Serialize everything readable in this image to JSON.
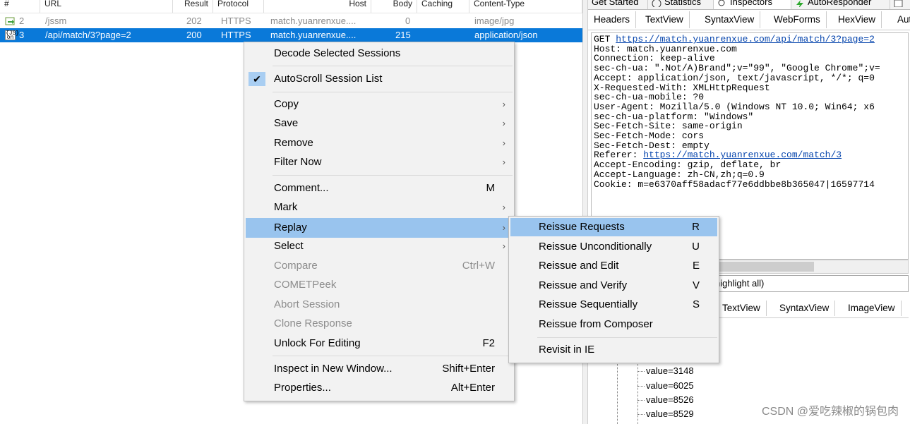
{
  "session_list": {
    "headers": [
      "#",
      "URL",
      "Result",
      "Protocol",
      "Host",
      "Body",
      "Caching",
      "Content-Type"
    ],
    "rows": [
      {
        "icon": "image-icon",
        "num": "2",
        "url": "/jssm",
        "result": "202",
        "protocol": "HTTPS",
        "host": "match.yuanrenxue....",
        "body": "0",
        "caching": "",
        "content_type": "image/jpg",
        "selected": false
      },
      {
        "icon": "json-icon",
        "num": "3",
        "url": "/api/match/3?page=2",
        "result": "200",
        "protocol": "HTTPS",
        "host": "match.yuanrenxue....",
        "body": "215",
        "caching": "",
        "content_type": "application/json",
        "selected": true
      }
    ]
  },
  "inspector": {
    "top_tabs": [
      "Get Started",
      "Statistics",
      "Inspectors",
      "AutoResponder"
    ],
    "request_tabs": [
      "Headers",
      "TextView",
      "SyntaxView",
      "WebForms",
      "HexView",
      "Aut"
    ],
    "request_lines": [
      {
        "prefix": "GET ",
        "link": "https://match.yuanrenxue.com/api/match/3?page=2",
        "suffix": ""
      },
      {
        "prefix": "Host: match.yuanrenxue.com",
        "link": "",
        "suffix": ""
      },
      {
        "prefix": "Connection: keep-alive",
        "link": "",
        "suffix": ""
      },
      {
        "prefix": "sec-ch-ua: \".Not/A)Brand\";v=\"99\", \"Google Chrome\";v=",
        "link": "",
        "suffix": ""
      },
      {
        "prefix": "Accept: application/json, text/javascript, */*; q=0",
        "link": "",
        "suffix": ""
      },
      {
        "prefix": "X-Requested-With: XMLHttpRequest",
        "link": "",
        "suffix": ""
      },
      {
        "prefix": "sec-ch-ua-mobile: ?0",
        "link": "",
        "suffix": ""
      },
      {
        "prefix": "User-Agent: Mozilla/5.0 (Windows NT 10.0; Win64; x6",
        "link": "",
        "suffix": ""
      },
      {
        "prefix": "sec-ch-ua-platform: \"Windows\"",
        "link": "",
        "suffix": ""
      },
      {
        "prefix": "Sec-Fetch-Site: same-origin",
        "link": "",
        "suffix": ""
      },
      {
        "prefix": "Sec-Fetch-Mode: cors",
        "link": "",
        "suffix": ""
      },
      {
        "prefix": "Sec-Fetch-Dest: empty",
        "link": "",
        "suffix": ""
      },
      {
        "prefix": "Referer: ",
        "link": "https://match.yuanrenxue.com/match/3",
        "suffix": ""
      },
      {
        "prefix": "Accept-Encoding: gzip, deflate, br",
        "link": "",
        "suffix": ""
      },
      {
        "prefix": "Accept-Language: zh-CN,zh;q=0.9",
        "link": "",
        "suffix": ""
      },
      {
        "prefix": "Cookie: m=e6370aff58adacf77e6ddbbe8b365047|16597714",
        "link": "",
        "suffix": ""
      }
    ],
    "find_text": "highlight all)",
    "response_tabs": [
      "TextView",
      "SyntaxView",
      "ImageView"
    ],
    "tree_values": [
      "value=3148",
      "value=6025",
      "value=8526",
      "value=8529"
    ]
  },
  "context_menu": {
    "items": [
      {
        "label": "Decode Selected Sessions",
        "shortcut": "",
        "arrow": false,
        "disabled": false
      },
      {
        "sep": true
      },
      {
        "label": "AutoScroll Session List",
        "shortcut": "",
        "arrow": false,
        "disabled": false,
        "checked": true
      },
      {
        "sep": true
      },
      {
        "label": "Copy",
        "shortcut": "",
        "arrow": true,
        "disabled": false
      },
      {
        "label": "Save",
        "shortcut": "",
        "arrow": true,
        "disabled": false
      },
      {
        "label": "Remove",
        "shortcut": "",
        "arrow": true,
        "disabled": false
      },
      {
        "label": "Filter Now",
        "shortcut": "",
        "arrow": true,
        "disabled": false
      },
      {
        "sep": true
      },
      {
        "label": "Comment...",
        "shortcut": "M",
        "arrow": false,
        "disabled": false
      },
      {
        "label": "Mark",
        "shortcut": "",
        "arrow": true,
        "disabled": false
      },
      {
        "label": "Replay",
        "shortcut": "",
        "arrow": true,
        "disabled": false,
        "highlighted": true
      },
      {
        "label": "Select",
        "shortcut": "",
        "arrow": true,
        "disabled": false
      },
      {
        "label": "Compare",
        "shortcut": "Ctrl+W",
        "arrow": false,
        "disabled": true
      },
      {
        "label": "COMETPeek",
        "shortcut": "",
        "arrow": false,
        "disabled": true
      },
      {
        "label": "Abort Session",
        "shortcut": "",
        "arrow": false,
        "disabled": true
      },
      {
        "label": "Clone Response",
        "shortcut": "",
        "arrow": false,
        "disabled": true
      },
      {
        "label": "Unlock For Editing",
        "shortcut": "F2",
        "arrow": false,
        "disabled": false
      },
      {
        "sep": true
      },
      {
        "label": "Inspect in New Window...",
        "shortcut": "Shift+Enter",
        "arrow": false,
        "disabled": false
      },
      {
        "label": "Properties...",
        "shortcut": "Alt+Enter",
        "arrow": false,
        "disabled": false
      }
    ]
  },
  "replay_submenu": {
    "items": [
      {
        "label": "Reissue Requests",
        "shortcut": "R",
        "highlighted": true
      },
      {
        "label": "Reissue Unconditionally",
        "shortcut": "U"
      },
      {
        "label": "Reissue and Edit",
        "shortcut": "E"
      },
      {
        "label": "Reissue and Verify",
        "shortcut": "V"
      },
      {
        "label": "Reissue Sequentially",
        "shortcut": "S"
      },
      {
        "label": "Reissue from Composer",
        "shortcut": ""
      },
      {
        "sep": true
      },
      {
        "label": "Revisit in IE",
        "shortcut": ""
      }
    ]
  },
  "watermark": "CSDN @爱吃辣椒的锅包肉",
  "colors": {
    "selection": "#0a79d9",
    "menu_highlight": "#99c4ee",
    "link": "#0645ad"
  }
}
